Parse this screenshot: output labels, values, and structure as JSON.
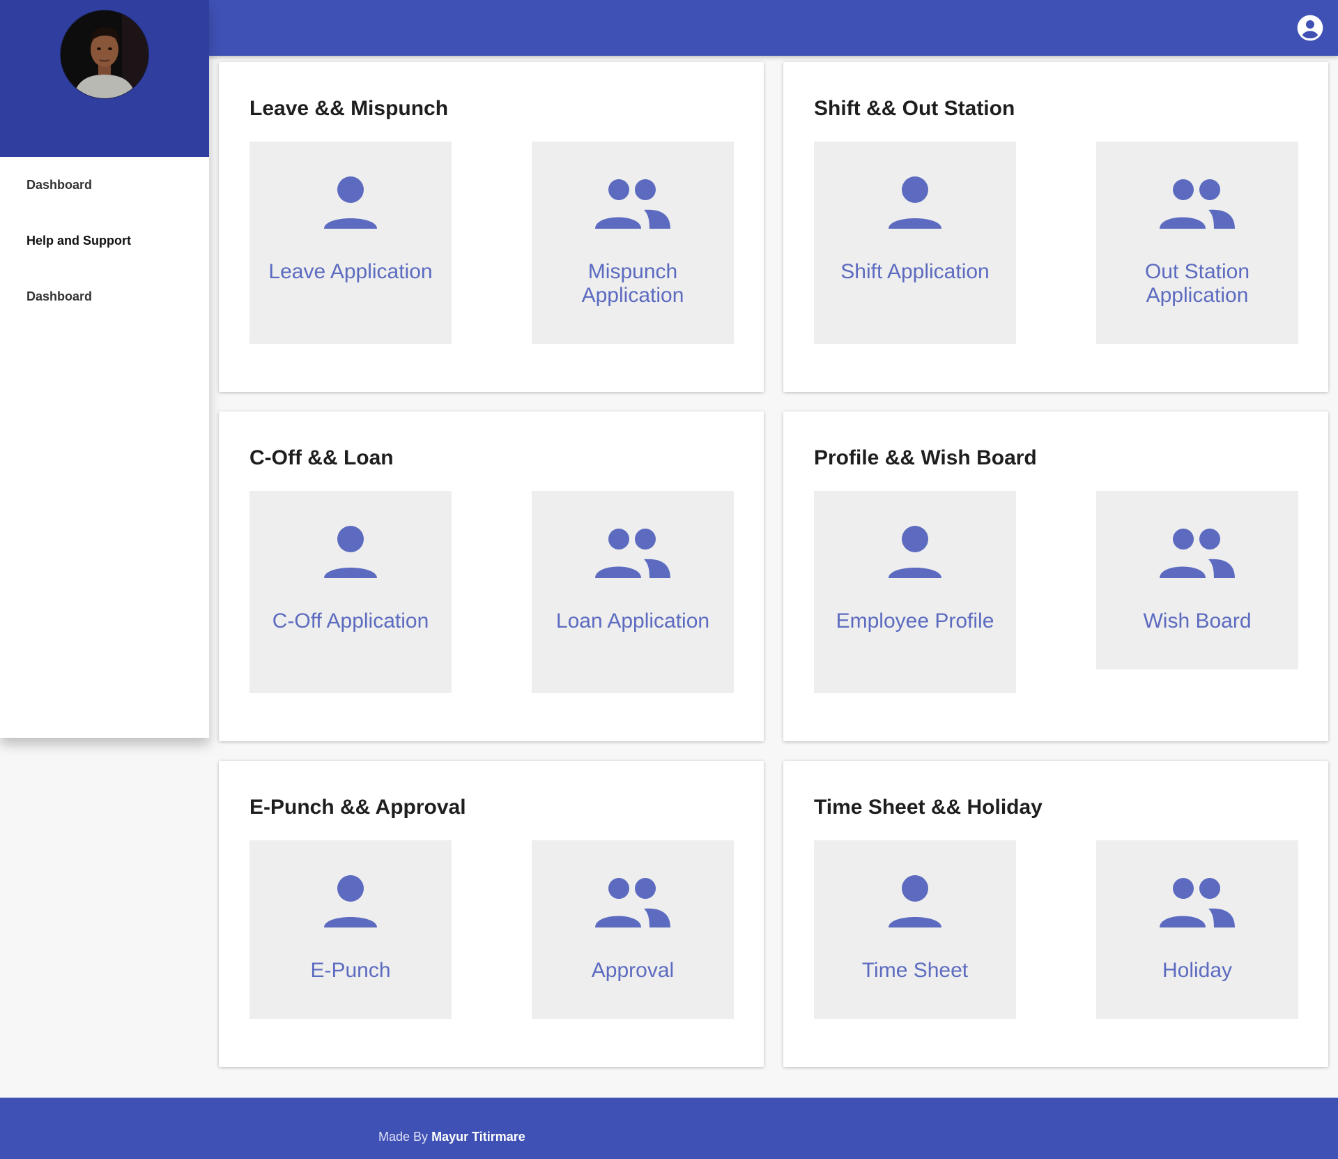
{
  "header": {
    "account_icon": "account-circle-icon",
    "color": "#3f51b5"
  },
  "sidebar": {
    "header_color": "#303f9f",
    "avatar_alt": "user avatar",
    "items": [
      {
        "label": "Dashboard"
      },
      {
        "label": "Help and Support"
      },
      {
        "label": "Dashboard"
      }
    ]
  },
  "cards": [
    {
      "title": "Leave && Mispunch",
      "tiles": [
        {
          "label": "Leave Application",
          "icon": "person-icon"
        },
        {
          "label": "Mispunch Application",
          "icon": "people-icon"
        }
      ]
    },
    {
      "title": "Shift && Out Station",
      "tiles": [
        {
          "label": "Shift Application",
          "icon": "person-icon"
        },
        {
          "label": "Out Station Application",
          "icon": "people-icon"
        }
      ]
    },
    {
      "title": "C-Off && Loan",
      "tiles": [
        {
          "label": "C-Off Application",
          "icon": "person-icon"
        },
        {
          "label": "Loan Application",
          "icon": "people-icon"
        }
      ]
    },
    {
      "title": "Profile && Wish Board",
      "tiles": [
        {
          "label": "Employee Profile",
          "icon": "person-icon"
        },
        {
          "label": "Wish Board",
          "icon": "people-icon"
        }
      ]
    },
    {
      "title": "E-Punch && Approval",
      "tiles": [
        {
          "label": "E-Punch",
          "icon": "person-icon"
        },
        {
          "label": "Approval",
          "icon": "people-icon"
        }
      ]
    },
    {
      "title": "Time Sheet && Holiday",
      "tiles": [
        {
          "label": "Time Sheet",
          "icon": "person-icon"
        },
        {
          "label": "Holiday",
          "icon": "people-icon"
        }
      ]
    }
  ],
  "footer": {
    "prefix": "Made By",
    "author": "Mayur Titirmare"
  },
  "colors": {
    "accent": "#5c6bc0",
    "tile_bg": "#eeeeee"
  }
}
